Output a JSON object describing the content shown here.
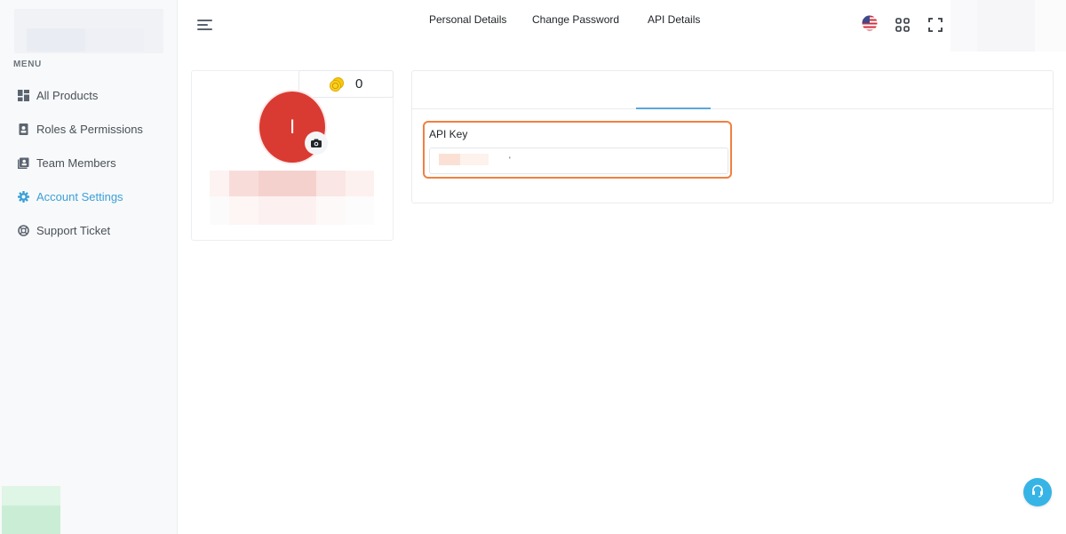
{
  "sidebar": {
    "menu_title": "MENU",
    "items": [
      {
        "label": "All Products",
        "icon": "grid-icon"
      },
      {
        "label": "Roles & Permissions",
        "icon": "badge-icon"
      },
      {
        "label": "Team Members",
        "icon": "contacts-icon"
      },
      {
        "label": "Account Settings",
        "icon": "gear-icon",
        "active": true
      },
      {
        "label": "Support Ticket",
        "icon": "lifebuoy-icon"
      }
    ]
  },
  "profile": {
    "credits": "0",
    "avatar_initial": "I"
  },
  "tabs": [
    {
      "label": "Personal Details"
    },
    {
      "label": "Change Password"
    },
    {
      "label": "API Details",
      "active": true
    }
  ],
  "api": {
    "label": "API Key",
    "value_suffix": "'"
  },
  "colors": {
    "accent": "#3aa0d8",
    "highlight": "#f08040",
    "avatar_bg": "#d93b32",
    "support_button": "#36b4e6"
  }
}
